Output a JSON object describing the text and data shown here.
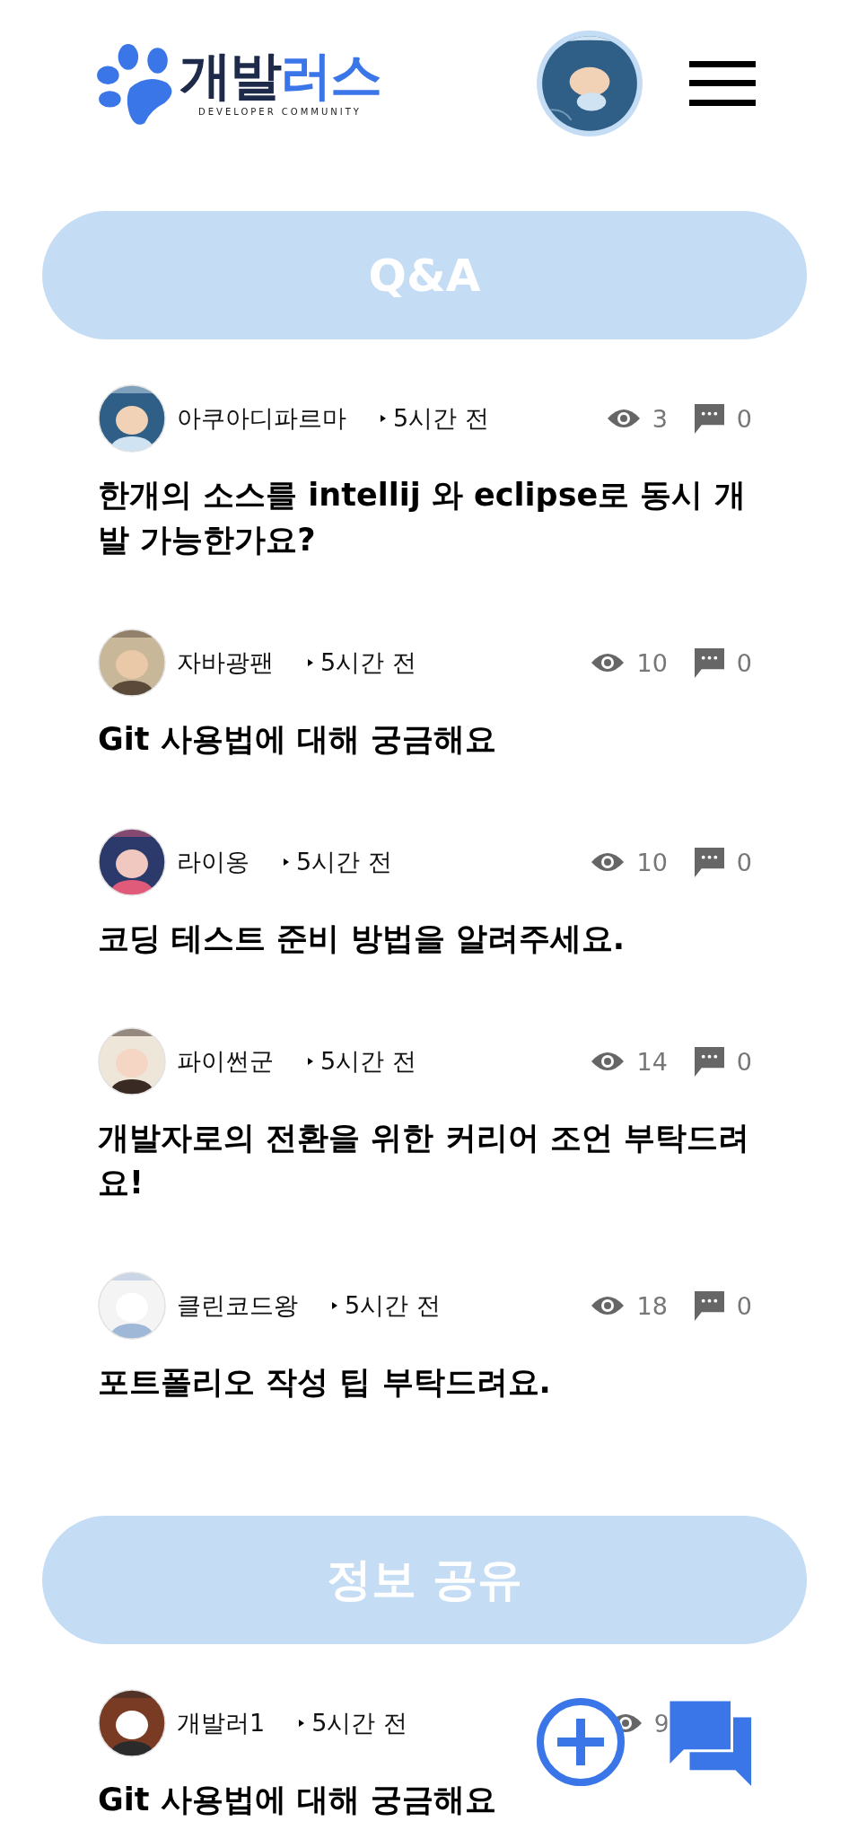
{
  "header": {
    "logo": {
      "name_dark": "개발",
      "name_accent": "러스",
      "tagline": "DEVELOPER COMMUNITY"
    }
  },
  "sections": [
    {
      "title": "Q&A",
      "posts": [
        {
          "author": "아쿠아디파르마",
          "time": "5시간 전",
          "views": "3",
          "comments": "0",
          "title": "한개의 소스를 intellij 와 eclipse로 동시 개발 가능한가요?"
        },
        {
          "author": "자바광팬",
          "time": "5시간 전",
          "views": "10",
          "comments": "0",
          "title": "Git 사용법에 대해 궁금해요"
        },
        {
          "author": "라이옹",
          "time": "5시간 전",
          "views": "10",
          "comments": "0",
          "title": "코딩 테스트 준비 방법을 알려주세요."
        },
        {
          "author": "파이썬군",
          "time": "5시간 전",
          "views": "14",
          "comments": "0",
          "title": "개발자로의 전환을 위한 커리어 조언 부탁드려요!"
        },
        {
          "author": "클린코드왕",
          "time": "5시간 전",
          "views": "18",
          "comments": "0",
          "title": "포트폴리오 작성 팁 부탁드려요."
        }
      ]
    },
    {
      "title": "정보 공유",
      "posts": [
        {
          "author": "개발러1",
          "time": "5시간 전",
          "views": "9",
          "title": "Git 사용법에 대해 궁금해요"
        }
      ]
    }
  ]
}
